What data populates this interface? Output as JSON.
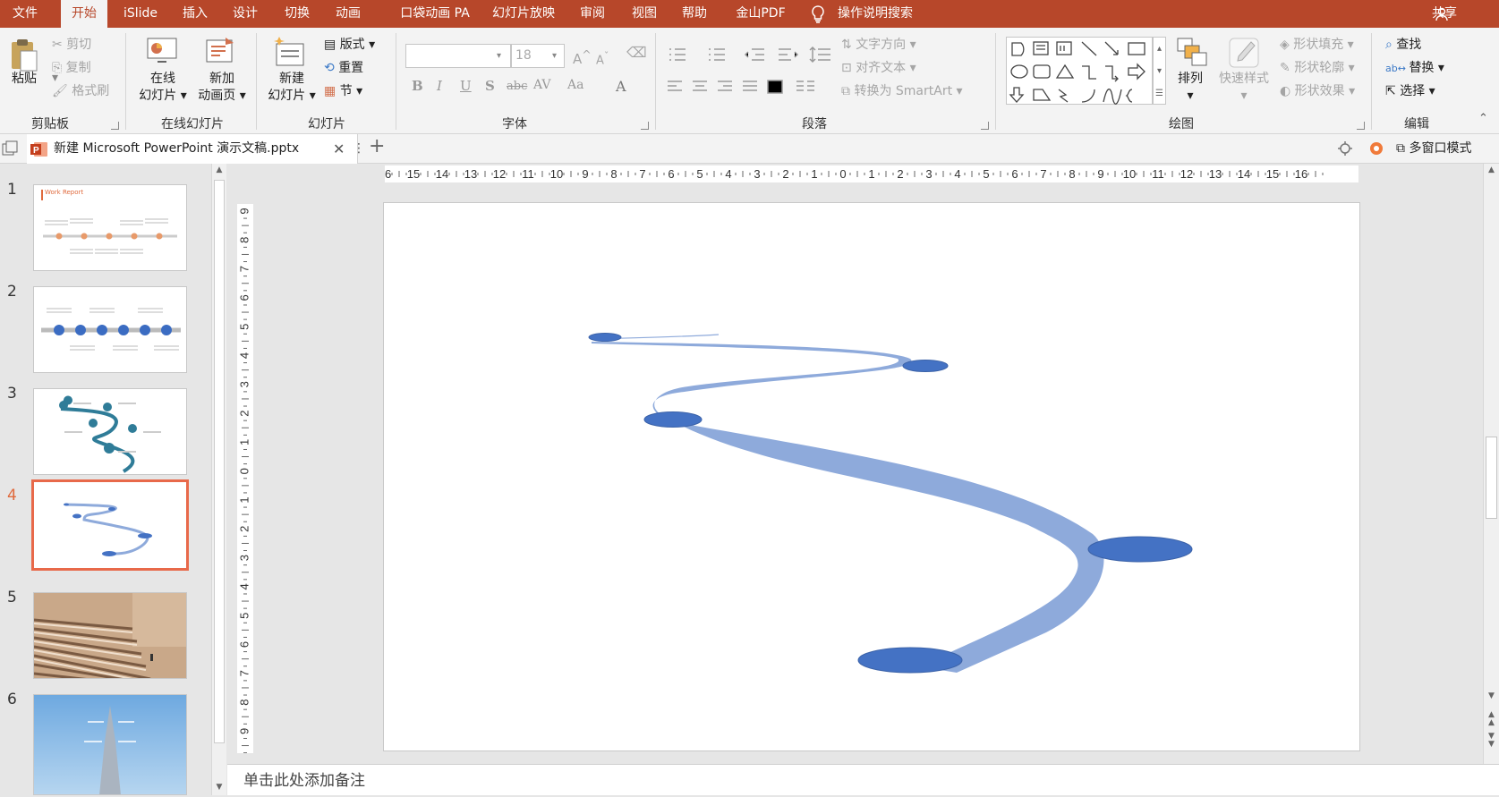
{
  "titlebar": {
    "tabs": [
      "文件",
      "开始",
      "iSlide",
      "插入",
      "设计",
      "切换",
      "动画",
      "口袋动画 PA",
      "幻灯片放映",
      "审阅",
      "视图",
      "帮助",
      "金山PDF"
    ],
    "active_tab": "开始",
    "search": "操作说明搜索",
    "share": "共享"
  },
  "ribbon": {
    "clipboard": {
      "paste": "粘贴",
      "cut": "剪切",
      "copy": "复制",
      "format_painter": "格式刷",
      "label": "剪贴板"
    },
    "online": {
      "online_slides_1": "在线",
      "online_slides_2": "幻灯片",
      "new_anim_1": "新加",
      "new_anim_2": "动画页",
      "label": "在线幻灯片"
    },
    "slides": {
      "new_1": "新建",
      "new_2": "幻灯片",
      "layout": "版式",
      "reset": "重置",
      "section": "节",
      "label": "幻灯片"
    },
    "font": {
      "name": "",
      "size": "18",
      "bold": "B",
      "italic": "I",
      "underline": "U",
      "shadow": "S",
      "strike": "abc",
      "spacing": "AV",
      "case": "Aa",
      "color": "A",
      "grow": "A",
      "shrink": "A",
      "label": "字体"
    },
    "paragraph": {
      "text_dir": "文字方向",
      "align_text": "对齐文本",
      "smartart": "转换为 SmartArt",
      "label": "段落"
    },
    "drawing": {
      "arrange": "排列",
      "quick_styles": "快速样式",
      "fill": "形状填充",
      "outline": "形状轮廓",
      "effects": "形状效果",
      "label": "绘图"
    },
    "editing": {
      "find": "查找",
      "replace": "替换",
      "select": "选择",
      "label": "编辑"
    }
  },
  "doc_tab": {
    "title": "新建 Microsoft PowerPoint 演示文稿.pptx",
    "multiwindow": "多窗口模式"
  },
  "hruler_labels": [
    "16",
    "15",
    "14",
    "13",
    "12",
    "11",
    "10",
    "9",
    "8",
    "7",
    "6",
    "5",
    "4",
    "3",
    "2",
    "1",
    "0",
    "1",
    "2",
    "3",
    "4",
    "5",
    "6",
    "7",
    "8",
    "9",
    "10",
    "11",
    "12",
    "13",
    "14",
    "15",
    "16"
  ],
  "vruler_labels": [
    "9",
    "8",
    "7",
    "6",
    "5",
    "4",
    "3",
    "2",
    "1",
    "0",
    "1",
    "2",
    "3",
    "4",
    "5",
    "6",
    "7",
    "8",
    "9"
  ],
  "thumbnails": {
    "numbers": [
      "1",
      "2",
      "3",
      "4",
      "5",
      "6"
    ],
    "active": "4",
    "slide1_title": "Work Report"
  },
  "colors": {
    "accent": "#b7472a",
    "path": "#8eaadb",
    "node": "#4472c4",
    "active_thumb": "#e8694a"
  },
  "notes": "单击此处添加备注"
}
